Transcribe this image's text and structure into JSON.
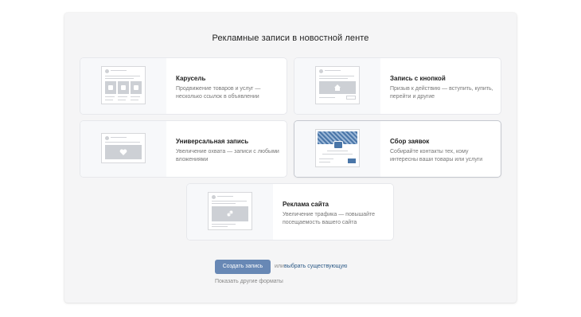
{
  "dialog": {
    "title": "Рекламные записи в новостной ленте"
  },
  "formats": [
    {
      "title": "Карусель",
      "description": "Продвижение товаров и услуг — несколько ссылок в объявлении"
    },
    {
      "title": "Запись с кнопкой",
      "description": "Призыв к действию — вступить, купить, перейти и другие"
    },
    {
      "title": "Универсальная запись",
      "description": "Увеличение охвата — записи с любыми вложениями"
    },
    {
      "title": "Сбор заявок",
      "description": "Собирайте контакты тех, кому интересны ваши товары или услуги"
    },
    {
      "title": "Реклама сайта",
      "description": "Увеличение трафика — повышайте посещаемость вашего сайта"
    }
  ],
  "actions": {
    "create_label": "Создать запись",
    "or_text": "или",
    "choose_existing_label": "выбрать существующую",
    "show_more_label": "Показать другие форматы"
  },
  "icons": {
    "carousel": "carousel-icon",
    "button_post": "home-icon",
    "universal": "heart-icon",
    "leads": "form-icon",
    "site": "link-icon"
  },
  "colors": {
    "primary_button": "#6888b5",
    "link": "#2a5885",
    "leads_accent": "#4a76a8"
  }
}
